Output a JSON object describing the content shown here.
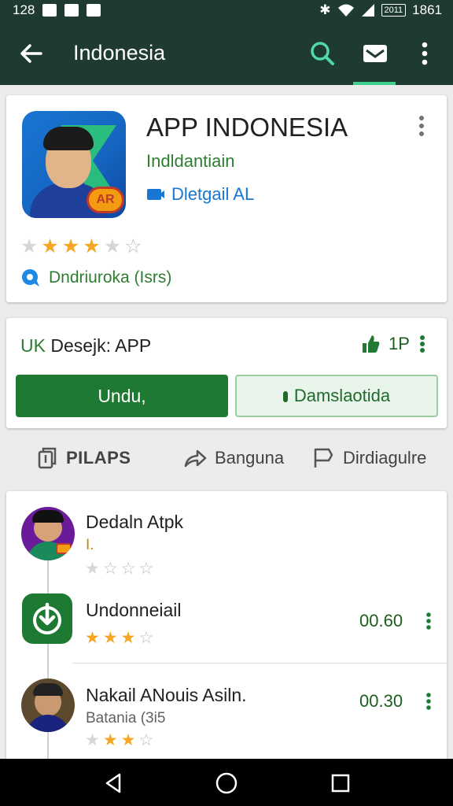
{
  "status_bar": {
    "time": "128",
    "battery": "2011",
    "clock": "1861"
  },
  "app_bar": {
    "title": "Indonesia"
  },
  "app": {
    "title": "APP INDONESIA",
    "developer": "Indldantiain",
    "detail_link": "Dletgail AL",
    "rating": 3,
    "rating_max": 5,
    "reviews": "Dndriuroka (Isrs)",
    "icon_badge": "AR"
  },
  "install": {
    "label_prefix": "UK",
    "label_rest": " Desejk: APP",
    "size": "1P",
    "primary_button": "Undu,",
    "secondary_button": "Damslaotida"
  },
  "actions": [
    {
      "label": "PILAPS",
      "icon": "bookmark-stack-icon"
    },
    {
      "label": "Banguna",
      "icon": "share-icon"
    },
    {
      "label": "Dirdiagulre",
      "icon": "flag-icon"
    }
  ],
  "list": [
    {
      "title": "Dedaln Atpk",
      "subtitle": "I.",
      "rating": 1,
      "price": "",
      "avatar": "person-avatar"
    },
    {
      "title": "Undonneiail",
      "subtitle": "",
      "rating": 3,
      "price": "00.60",
      "avatar": "download-icon"
    },
    {
      "title": "Nakail ANouis Asiln.",
      "subtitle": "Batania (3i5",
      "rating": 3,
      "price": "00.30",
      "avatar": "person-avatar"
    }
  ],
  "colors": {
    "appbar": "#1f3a32",
    "accent_green": "#1e7a32",
    "star": "#f5a623",
    "link_blue": "#1976d2"
  }
}
